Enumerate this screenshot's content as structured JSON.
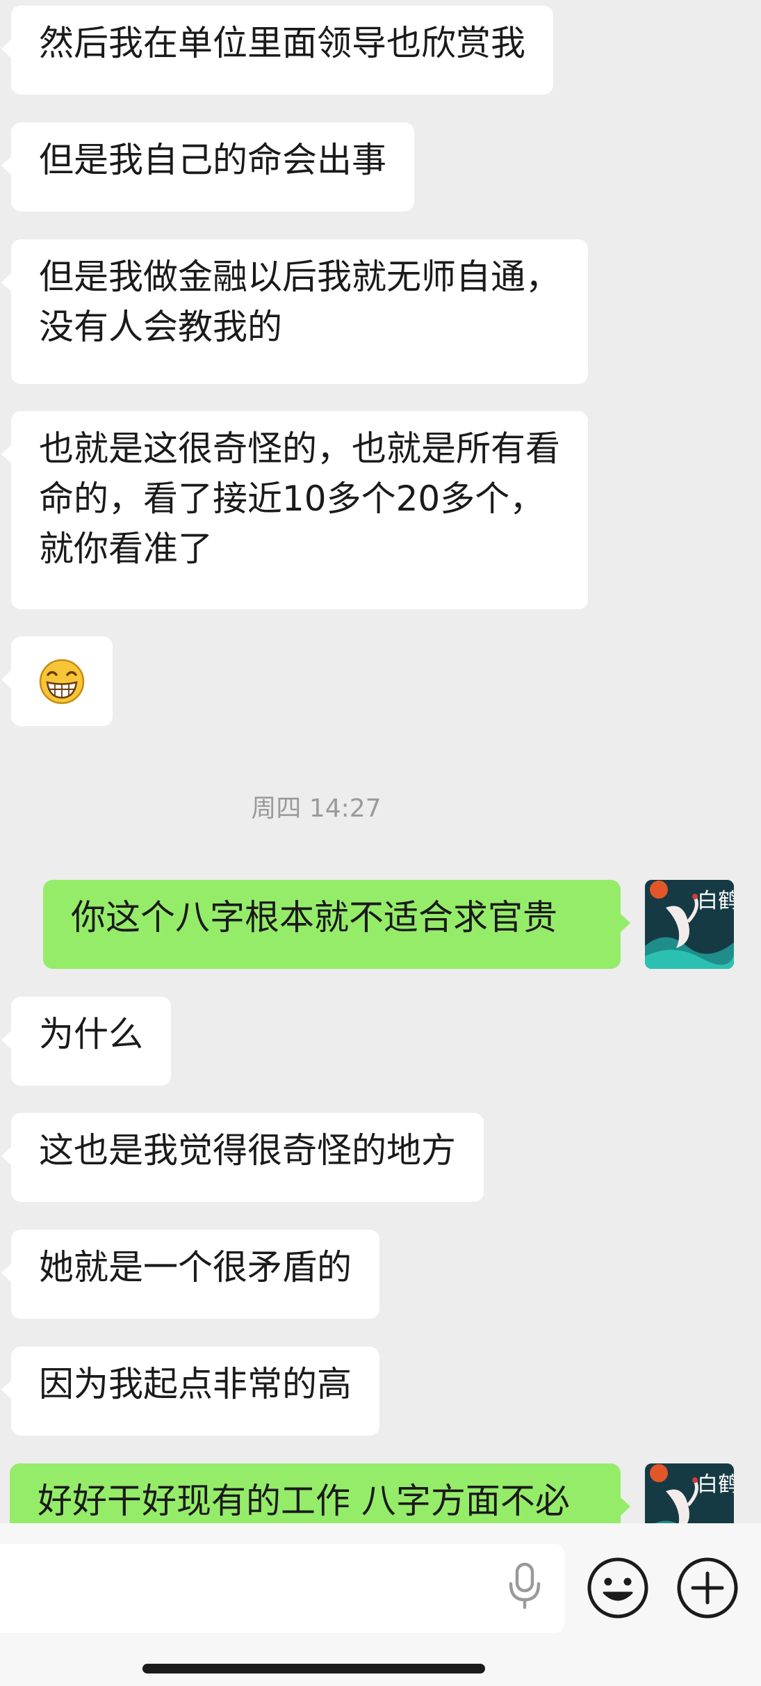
{
  "messages": [
    {
      "side": "in",
      "lines": [
        "然后我在单位里面领导也欣赏我"
      ]
    },
    {
      "side": "in",
      "lines": [
        "但是我自己的命会出事"
      ]
    },
    {
      "side": "in",
      "lines": [
        "但是我做金融以后我就无师自通，",
        "没有人会教我的"
      ]
    },
    {
      "side": "in",
      "lines": [
        "也就是这很奇怪的，也就是所有看",
        "命的，看了接近10多个20多个，",
        "就你看准了"
      ]
    },
    {
      "side": "in",
      "emoji": "grinning-face-with-smiling-eyes"
    },
    {
      "timestamp": "周四 14:27"
    },
    {
      "side": "out",
      "lines": [
        "你这个八字根本就不适合求官贵"
      ],
      "avatar_text": "白鹤"
    },
    {
      "side": "in",
      "lines": [
        "为什么"
      ]
    },
    {
      "side": "in",
      "lines": [
        "这也是我觉得很奇怪的地方"
      ]
    },
    {
      "side": "in",
      "lines": [
        "她就是一个很矛盾的"
      ]
    },
    {
      "side": "in",
      "lines": [
        "因为我起点非常的高"
      ]
    },
    {
      "side": "out",
      "lines": [
        "好好干好现有的工作 八字方面不必"
      ],
      "avatar_text": "白鹤"
    }
  ],
  "input_bar": {
    "icons": [
      "microphone-icon",
      "emoji-icon",
      "plus-icon"
    ]
  },
  "colors": {
    "background": "#ededed",
    "incoming_bubble": "#ffffff",
    "outgoing_bubble": "#95ec69"
  }
}
